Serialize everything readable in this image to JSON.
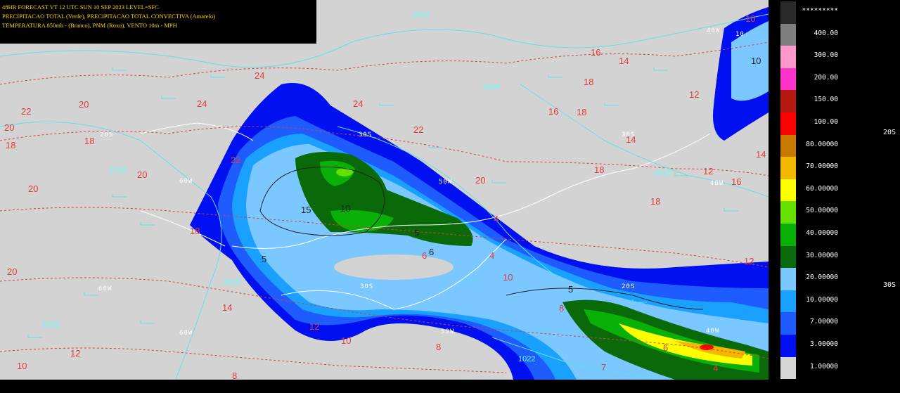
{
  "header": {
    "line1": "48HR FORECAST   VT 12 UTC SUN 10 SEP 2023   LEVEL=SFC",
    "line2": "PRECIPITACAO TOTAL (Verde), PRECIPITACAO TOTAL CONVECTIVA (Amarelo)",
    "line3": "TEMPERATURA 850mb - (Branco), PNM (Roxo), VENTO 10m - MPH"
  },
  "legend": [
    {
      "label": "*********",
      "color": "#2a2a2a"
    },
    {
      "label": "400.00",
      "color": "#7f7f7f"
    },
    {
      "label": "300.00",
      "color": "#ff99cc"
    },
    {
      "label": "200.00",
      "color": "#ff33cc"
    },
    {
      "label": "150.00",
      "color": "#b51a10"
    },
    {
      "label": "100.00",
      "color": "#ff0000"
    },
    {
      "label": "80.00000",
      "color": "#c87a00"
    },
    {
      "label": "70.00000",
      "color": "#f2b700"
    },
    {
      "label": "60.00000",
      "color": "#ffff00"
    },
    {
      "label": "50.00000",
      "color": "#66e000"
    },
    {
      "label": "40.00000",
      "color": "#08b008"
    },
    {
      "label": "30.00000",
      "color": "#0a6a0a"
    },
    {
      "label": "20.00000",
      "color": "#7ac8ff"
    },
    {
      "label": "10.00000",
      "color": "#1aa0ff"
    },
    {
      "label": "7.00000",
      "color": "#1e5cff"
    },
    {
      "label": "3.00000",
      "color": "#0010f0"
    },
    {
      "label": "1.00000",
      "color": "#d6d6d6"
    }
  ],
  "side_labels": {
    "lat_20s": "20S",
    "lat_30s": "30S"
  },
  "map_labels": {
    "red": [
      "22",
      "20",
      "20",
      "18",
      "20",
      "20",
      "24",
      "24",
      "24",
      "22",
      "20",
      "22",
      "20",
      "18",
      "18",
      "16",
      "18",
      "18",
      "16",
      "14",
      "18",
      "14",
      "16",
      "18",
      "12",
      "14",
      "12",
      "10",
      "8",
      "12",
      "10",
      "10",
      "12",
      "14",
      "12",
      "10",
      "8",
      "8",
      "6",
      "4",
      "6",
      "7",
      "4",
      "4"
    ],
    "dark": [
      "15",
      "10",
      "5",
      "5",
      "5",
      "6",
      "10"
    ],
    "white": [
      "20S",
      "30S",
      "30S",
      "50W",
      "60W",
      "60W",
      "60W",
      "40W",
      "40W",
      "40W",
      "50W",
      "20S",
      "20S",
      "30S",
      "10"
    ],
    "cyan": [
      "1012",
      "1016",
      "1010",
      "1020",
      "1018",
      "1018",
      "1022"
    ]
  }
}
